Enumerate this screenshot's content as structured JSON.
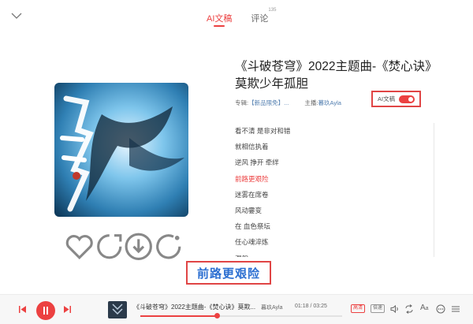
{
  "tabs": [
    {
      "label": "AI文稿"
    },
    {
      "label": "评论",
      "count": "135"
    }
  ],
  "song": {
    "title": "《斗破苍穹》2022主题曲-《焚心诀》莫欺少年孤胆",
    "album_label": "专辑:",
    "album": "【新品限免】...",
    "singer_label": "主播:",
    "singer": "暮玖Ayla"
  },
  "ai_toggle": {
    "label": "AI文稿",
    "enabled": true
  },
  "lyrics": [
    {
      "text": "看不清 是非对和错",
      "current": false
    },
    {
      "text": "就相信执着",
      "current": false
    },
    {
      "text": "逆风 挣开 牵绊",
      "current": false
    },
    {
      "text": "前路更艰险",
      "current": true
    },
    {
      "text": "迷雾在席卷",
      "current": false
    },
    {
      "text": "风动霎变",
      "current": false
    },
    {
      "text": "在 血色祭坛",
      "current": false
    },
    {
      "text": "任心魂淬炼",
      "current": false
    },
    {
      "text": "涅槃",
      "current": false
    }
  ],
  "current_line": "前路更艰险",
  "player": {
    "now_playing": "《斗破苍穹》2022主题曲-《焚心诀》莫欺...",
    "artist": "暮玖Ayla",
    "time": "01:18 / 03:25",
    "progress": 0.38,
    "quality_badge": "高清",
    "speed_badge": "倍速",
    "text_size": "A",
    "text_size_sub": "a"
  },
  "colors": {
    "accent": "#ec4141",
    "link": "#507daf",
    "float_text": "#2c6fd1"
  },
  "icons": [
    "collapse-chevron-icon",
    "minimize-icon",
    "maximize-icon",
    "close-icon",
    "heart-icon",
    "share-icon",
    "download-icon",
    "comment-icon",
    "prev-icon",
    "pause-icon",
    "next-icon",
    "volume-icon",
    "loop-icon",
    "more-icon",
    "playlist-icon"
  ]
}
